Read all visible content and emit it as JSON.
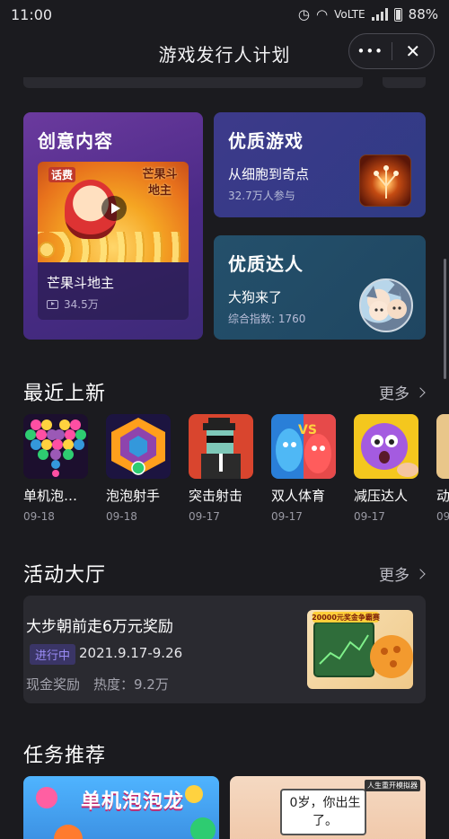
{
  "status": {
    "time": "11:00",
    "network": "VoLTE",
    "battery": "88%"
  },
  "header": {
    "title": "游戏发行人计划",
    "more_glyph": "•••",
    "close_glyph": "✕"
  },
  "creative": {
    "title": "创意内容",
    "video_name": "芒果斗地主",
    "views": "34.5万",
    "thumb_tag": "话费",
    "thumb_logo": "芒果斗地主"
  },
  "quality_game": {
    "title": "优质游戏",
    "name": "从细胞到奇点",
    "meta": "32.7万人参与"
  },
  "quality_talent": {
    "title": "优质达人",
    "name": "大狗来了",
    "meta": "综合指数: 1760"
  },
  "recent": {
    "title": "最近上新",
    "more": "更多",
    "games": [
      {
        "name": "单机泡…",
        "date": "09-18",
        "icon": "bubble-heart-icon"
      },
      {
        "name": "泡泡射手",
        "date": "09-18",
        "icon": "bubble-hex-icon"
      },
      {
        "name": "突击射击",
        "date": "09-17",
        "icon": "sniper-agent-icon"
      },
      {
        "name": "双人体育",
        "date": "09-17",
        "icon": "versus-blobs-icon"
      },
      {
        "name": "减压达人",
        "date": "09-17",
        "icon": "stress-face-icon"
      },
      {
        "name": "动",
        "date": "09",
        "icon": "partial-game-icon"
      }
    ]
  },
  "events": {
    "title": "活动大厅",
    "more": "更多",
    "item": {
      "title": "大步朝前走6万元奖励",
      "status": "进行中",
      "date": "2021.9.17-9.26",
      "meta": "现金奖励　热度：9.2万",
      "thumb_text": "20000元奖金争霸赛"
    }
  },
  "tasks": {
    "title": "任务推荐",
    "a_text": "单机泡泡龙",
    "b_bubble": "0岁，你出生了。",
    "b_tag": "人生重开模拟器"
  },
  "colors": {
    "bg": "#1b1b1f",
    "accent": "#9b8cf6",
    "creative": "#5a3594",
    "game_card": "#363b88",
    "talent_card": "#214b66"
  }
}
